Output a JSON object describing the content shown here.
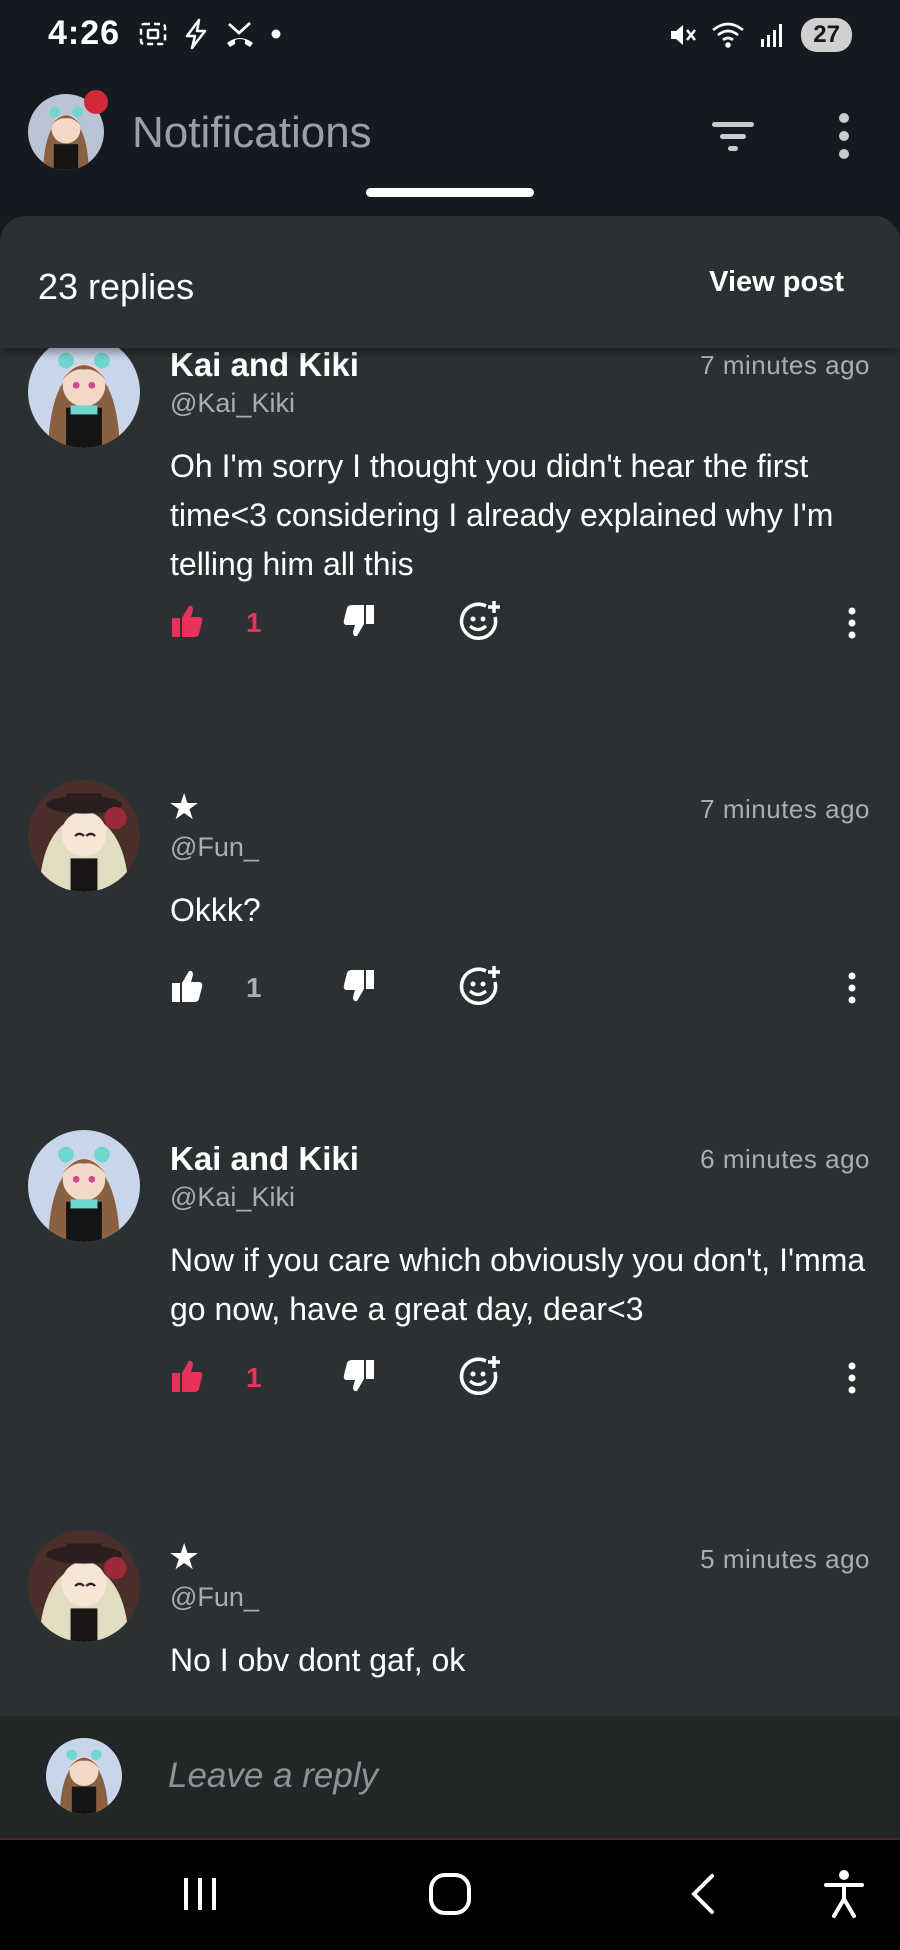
{
  "status_bar": {
    "time": "4:26",
    "battery": "27",
    "left_icons": [
      "screenshot-icon",
      "flash-icon",
      "missed-call-icon",
      "dot-icon"
    ],
    "right_icons": [
      "mute-icon",
      "wifi-icon",
      "signal-icon"
    ]
  },
  "header": {
    "title": "Notifications",
    "filter_icon": "filter-icon",
    "more_icon": "more-vertical-icon"
  },
  "sheet": {
    "replies_count": "23 replies",
    "view_post": "View post"
  },
  "comments": [
    {
      "name": "Kai and Kiki",
      "handle": "@Kai_Kiki",
      "time": "7 minutes ago",
      "text": "Oh I'm sorry I thought you didn't hear the first time<3 considering I already explained why I'm telling him all this",
      "likes": "1",
      "liked": true,
      "avatar": "kai-kiki"
    },
    {
      "name": "★",
      "handle": "@Fun_",
      "time": "7 minutes ago",
      "text": "Okkk?",
      "likes": "1",
      "liked": false,
      "avatar": "fun"
    },
    {
      "name": "Kai and Kiki",
      "handle": "@Kai_Kiki",
      "time": "6 minutes ago",
      "text": "Now if you care which obviously you don't, I'mma go now, have a great day, dear<3",
      "likes": "1",
      "liked": true,
      "avatar": "kai-kiki"
    },
    {
      "name": "★",
      "handle": "@Fun_",
      "time": "5 minutes ago",
      "text": "No I obv dont gaf, ok",
      "avatar": "fun"
    }
  ],
  "reply_bar": {
    "placeholder": "Leave a reply"
  },
  "colors": {
    "liked": "#e8325a",
    "muted": "#a9aeb1",
    "sheet_bg": "#2b3132"
  }
}
